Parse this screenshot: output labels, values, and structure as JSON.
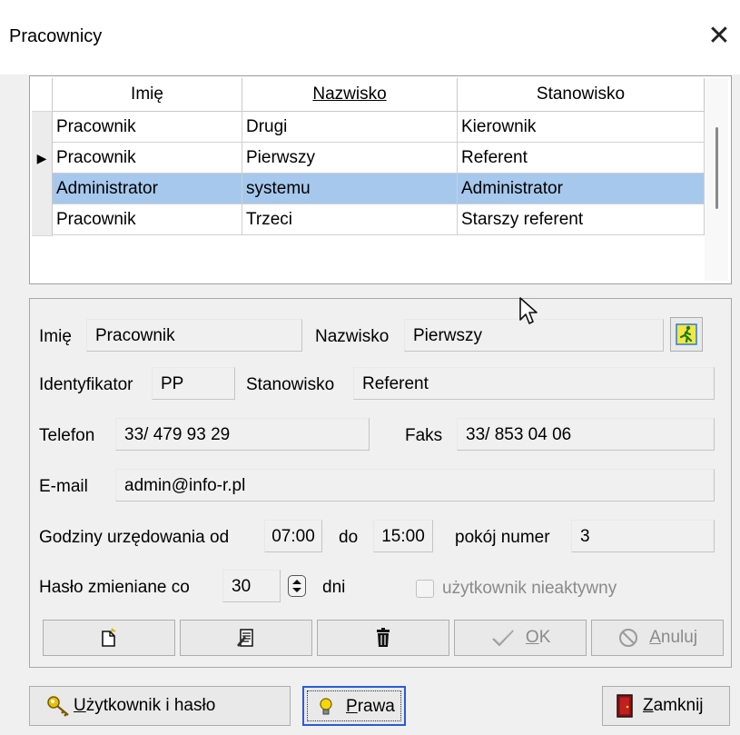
{
  "window": {
    "title": "Pracownicy",
    "close_glyph": "✕"
  },
  "grid": {
    "columns": [
      "Imię",
      "Nazwisko",
      "Stanowisko"
    ],
    "sorted_column": "Nazwisko",
    "current_row_marker": "▶",
    "rows": [
      [
        "Pracownik",
        "Drugi",
        "Kierownik"
      ],
      [
        "Pracownik",
        "Pierwszy",
        "Referent"
      ],
      [
        "Administrator",
        "systemu",
        "Administrator"
      ],
      [
        "Pracownik",
        "Trzeci",
        "Starszy referent"
      ]
    ],
    "selected_row": 2,
    "current_row": 1,
    "selection_color": "#a6c8ec"
  },
  "form": {
    "imie_label": "Imię",
    "imie_value": "Pracownik",
    "nazwisko_label": "Nazwisko",
    "nazwisko_value": "Pierwszy",
    "identyfikator_label": "Identyfikator",
    "identyfikator_value": "PP",
    "stanowisko_label": "Stanowisko",
    "stanowisko_value": "Referent",
    "telefon_label": "Telefon",
    "telefon_value": "33/ 479 93 29",
    "faks_label": "Faks",
    "faks_value": "33/ 853 04 06",
    "email_label": "E-mail",
    "email_value": "admin@info-r.pl",
    "godziny_label": "Godziny urzędowania od",
    "godziny_od": "07:00",
    "do_label": "do",
    "godziny_do": "15:00",
    "pokoj_label": "pokój numer",
    "pokoj_value": "3",
    "haslo_label": "Hasło zmieniane co",
    "haslo_value": "30",
    "dni_label": "dni",
    "nieaktywny_label": "użytkownik nieaktywny",
    "nieaktywny_checked": false
  },
  "actions": {
    "new_icon": "new-document-icon",
    "edit_icon": "edit-document-icon",
    "delete_icon": "trash-icon",
    "ok_label": "OK",
    "ok_mnemonic": "O",
    "ok_rest": "K",
    "anuluj_mnemonic": "A",
    "anuluj_rest": "nuluj"
  },
  "bottom": {
    "user_mnemonic": "U",
    "user_rest": "żytkownik i hasło",
    "prawa_mnemonic": "P",
    "prawa_rest": "rawa",
    "zamknij_mnemonic": "Z",
    "zamknij_rest": "amknij"
  },
  "colors": {
    "accent": "#2a5bd7",
    "door": "#b01a1a",
    "run_icon_bg": "#f5e642"
  }
}
